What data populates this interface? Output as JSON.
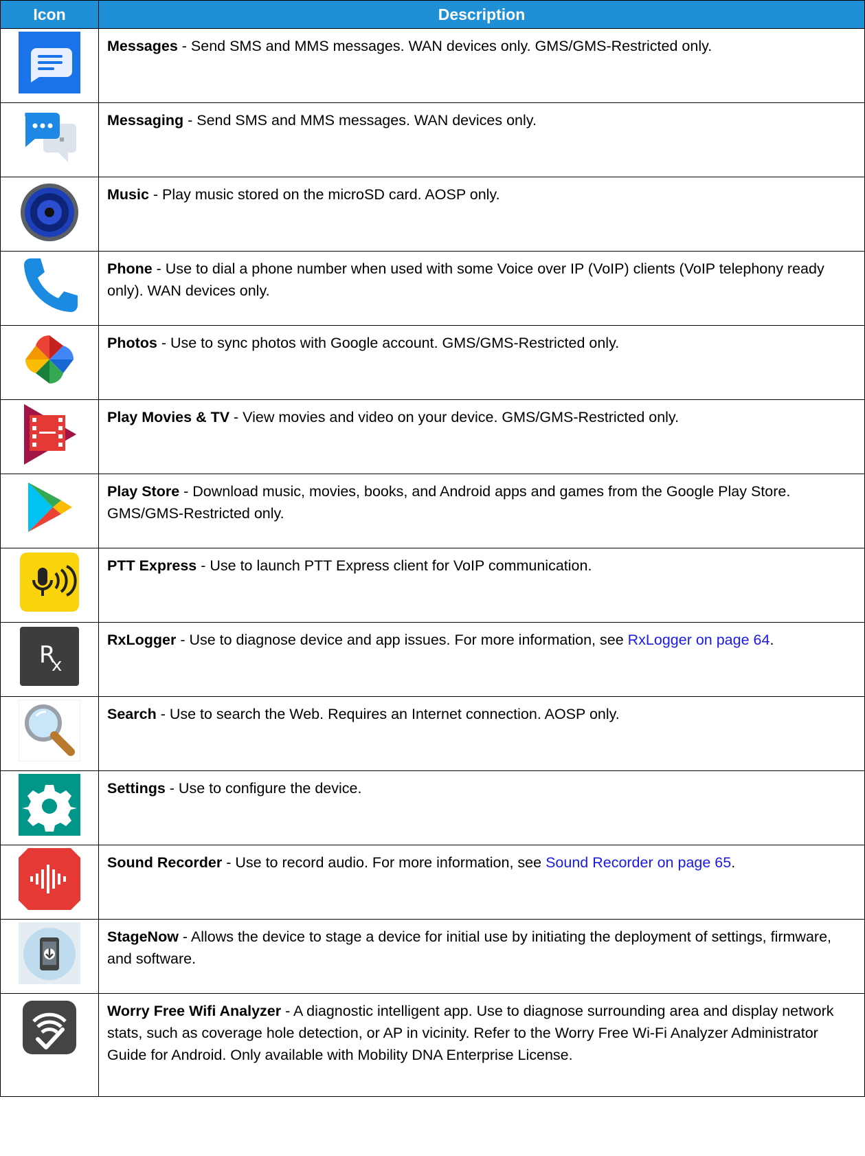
{
  "table": {
    "headers": {
      "icon": "Icon",
      "description": "Description"
    },
    "rows": [
      {
        "icon": "messages-icon",
        "name": "Messages",
        "text": " - Send SMS and MMS messages. WAN devices only. GMS/GMS-Restricted only.",
        "link": "",
        "link_after": ""
      },
      {
        "icon": "messaging-icon",
        "name": "Messaging",
        "text": " - Send SMS and MMS messages. WAN devices only.",
        "link": "",
        "link_after": ""
      },
      {
        "icon": "music-speaker-icon",
        "name": "Music",
        "text": " - Play music stored on the microSD card. AOSP only.",
        "link": "",
        "link_after": ""
      },
      {
        "icon": "phone-handset-icon",
        "name": "Phone",
        "text": " - Use to dial a phone number when used with some Voice over IP (VoIP) clients (VoIP telephony ready only). WAN devices only.",
        "link": "",
        "link_after": ""
      },
      {
        "icon": "photos-pinwheel-icon",
        "name": "Photos",
        "text": " - Use to sync photos with Google account. GMS/GMS-Restricted only.",
        "link": "",
        "link_after": ""
      },
      {
        "icon": "play-movies-icon",
        "name": "Play Movies & TV",
        "text": " - View movies and video on your device. GMS/GMS-Restricted only.",
        "link": "",
        "link_after": ""
      },
      {
        "icon": "play-store-icon",
        "name": "Play Store",
        "text": " - Download music, movies, books, and Android apps and games from the Google Play Store. GMS/GMS-Restricted only.",
        "link": "",
        "link_after": ""
      },
      {
        "icon": "ptt-express-microphone-icon",
        "name": "PTT Express",
        "text": " - Use to launch PTT Express client for VoIP communication.",
        "link": "",
        "link_after": ""
      },
      {
        "icon": "rxlogger-icon",
        "name": "RxLogger",
        "text": " - Use to diagnose device and app issues. For more information, see ",
        "link": "RxLogger on page 64",
        "link_after": "."
      },
      {
        "icon": "search-magnifier-icon",
        "name": "Search",
        "text": " - Use to search the Web. Requires an Internet connection. AOSP only.",
        "link": "",
        "link_after": ""
      },
      {
        "icon": "settings-gear-icon",
        "name": "Settings",
        "text": " - Use to configure the device.",
        "link": "",
        "link_after": ""
      },
      {
        "icon": "sound-recorder-icon",
        "name": "Sound Recorder",
        "text": " - Use to record audio. For more information, see ",
        "link": "Sound Recorder on page 65",
        "link_after": "."
      },
      {
        "icon": "stagenow-icon",
        "name": "StageNow",
        "text": " - Allows the device to stage a device for initial use by initiating the deployment of settings, firmware, and software.",
        "link": "",
        "link_after": ""
      },
      {
        "icon": "wifi-analyzer-icon",
        "name": "Worry Free Wifi Analyzer",
        "text": " - A diagnostic intelligent app. Use to diagnose surrounding area and display network stats, such as coverage hole detection, or AP in vicinity. Refer to the Worry Free Wi-Fi Analyzer Administrator Guide for Android. Only available with Mobility DNA Enterprise License.",
        "link": "",
        "link_after": ""
      }
    ]
  }
}
